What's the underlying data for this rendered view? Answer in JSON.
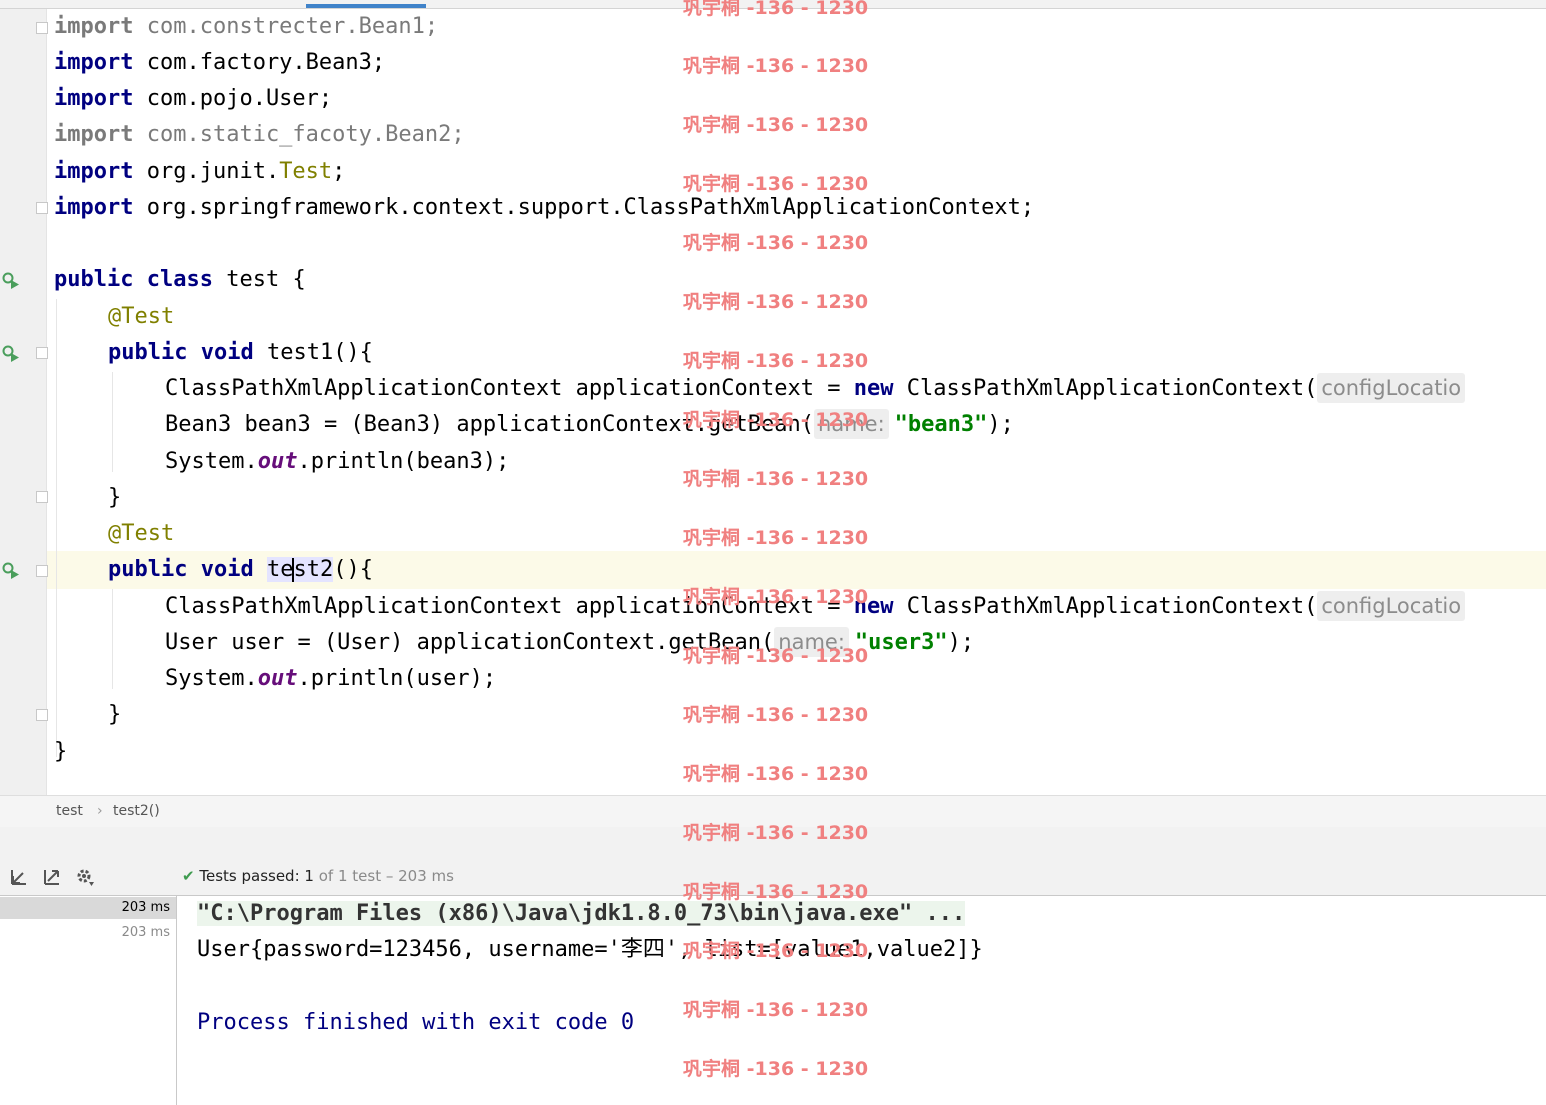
{
  "editor": {
    "imports": [
      {
        "keyword": "import",
        "path": "com.constrecter.Bean1;"
      },
      {
        "keyword": "import",
        "path": "com.factory.Bean3;"
      },
      {
        "keyword": "import",
        "path": "com.pojo.User;"
      },
      {
        "keyword": "import",
        "path": "com.static_facoty.Bean2;"
      },
      {
        "keyword": "import",
        "path_a": "org.junit.",
        "path_b": "Test",
        "path_c": ";"
      },
      {
        "keyword": "import",
        "path": "org.springframework.context.support.ClassPathXmlApplicationContext;"
      }
    ],
    "class_decl": {
      "kw1": "public",
      "kw2": "class",
      "rest": " test {"
    },
    "method1": {
      "annotation": "@Test",
      "kw1": "public",
      "kw2": "void",
      "name": " test1(){",
      "line1_a": "ClassPathXmlApplicationContext applicationContext = ",
      "line1_new": "new",
      "line1_b": " ClassPathXmlApplicationContext(",
      "line1_hint": "configLocatio",
      "line2_a": "Bean3 bean3 = (Bean3) applicationContext.getBean(",
      "line2_hint": "name:",
      "line2_str": "\"bean3\"",
      "line2_b": ");",
      "line3_a": "System.",
      "line3_field": "out",
      "line3_b": ".println(bean3);",
      "close": "}"
    },
    "method2": {
      "annotation": "@Test",
      "kw1": "public",
      "kw2": "void",
      "name_pre": "te",
      "name_sel": "st2",
      "name_post": "(){",
      "line1_a": "ClassPathXmlApplicationContext applicationContext = ",
      "line1_new": "new",
      "line1_b": " ClassPathXmlApplicationContext(",
      "line1_hint": "configLocatio",
      "line2_a": "User user = (User) applicationContext.getBean(",
      "line2_hint": "name:",
      "line2_str": "\"user3\"",
      "line2_b": ");",
      "line3_a": "System.",
      "line3_field": "out",
      "line3_b": ".println(user);",
      "close": "}"
    },
    "class_close": "}"
  },
  "watermark": "巩宇桐 -136 - 1230",
  "breadcrumb": {
    "item1": "test",
    "separator": "›",
    "item2": "test2()"
  },
  "run_panel": {
    "status_label": "Tests passed:",
    "status_count": "1",
    "status_detail": "of 1 test – 203 ms",
    "tree_rows": [
      "203 ms",
      "203 ms"
    ],
    "console": {
      "cmd": "\"C:\\Program Files (x86)\\Java\\jdk1.8.0_73\\bin\\java.exe\" ...",
      "output": "User{password=123456, username='李四', list=[value1,value2]}",
      "finish": "Process finished with exit code 0"
    }
  },
  "colors": {
    "keyword": "#000080",
    "string": "#008000",
    "annotation": "#808000",
    "field": "#660e7a",
    "watermark": "#f08080"
  },
  "icons": [
    "run-test-icon",
    "fold-icon",
    "import-tests-icon",
    "export-tests-icon",
    "gear-icon",
    "check-icon"
  ]
}
